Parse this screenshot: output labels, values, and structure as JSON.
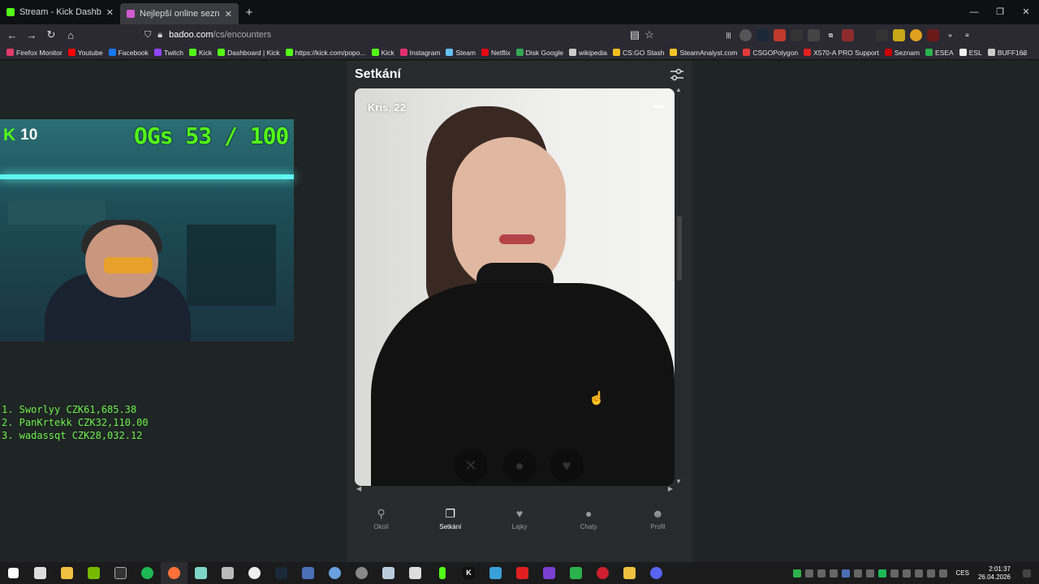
{
  "tabs": [
    {
      "title": "Stream - Kick Dashboard",
      "color": "#53fc18"
    },
    {
      "title": "Nejlepší online seznamka zdarma",
      "color": "#d35ad1"
    }
  ],
  "tab_close": "✕",
  "new_tab": "+",
  "window_controls": {
    "minimize": "—",
    "restore": "❐",
    "close": "✕"
  },
  "nav": {
    "back": "←",
    "forward": "→",
    "reload": "↻",
    "home": "⌂"
  },
  "url": {
    "host": "badoo.com",
    "path": "/cs/encounters"
  },
  "bookmarks": [
    {
      "label": "Firefox Monitor",
      "color": "#e23a6a"
    },
    {
      "label": "Youtube",
      "color": "#ff0000"
    },
    {
      "label": "Facebook",
      "color": "#1877f2"
    },
    {
      "label": "Twitch",
      "color": "#9146ff"
    },
    {
      "label": "Kick",
      "color": "#53fc18"
    },
    {
      "label": "Dashboard | Kick",
      "color": "#53fc18"
    },
    {
      "label": "https://kick.com/popo...",
      "color": "#53fc18"
    },
    {
      "label": "Kick",
      "color": "#53fc18"
    },
    {
      "label": "Instagram",
      "color": "#e1306c"
    },
    {
      "label": "Steam",
      "color": "#66c0f4"
    },
    {
      "label": "Netflix",
      "color": "#e50914"
    },
    {
      "label": "Disk Google",
      "color": "#34a853"
    },
    {
      "label": "wikipedia",
      "color": "#cccccc"
    },
    {
      "label": "CS:GO Stash",
      "color": "#f0c020"
    },
    {
      "label": "SteamAnalyst.com",
      "color": "#f5c428"
    },
    {
      "label": "CSGOPolygon",
      "color": "#e23a3a"
    },
    {
      "label": "X570-A PRO Support",
      "color": "#e02020"
    },
    {
      "label": "Seznam",
      "color": "#cc0000"
    },
    {
      "label": "ESEA",
      "color": "#2bb24c"
    },
    {
      "label": "ESL",
      "color": "#f0f0f0"
    },
    {
      "label": "BUFF163",
      "color": "#cccccc"
    }
  ],
  "bookmarks_more": "»",
  "stream": {
    "kick_count": "10",
    "kick_logo": "K",
    "ogs": "OGs 53 / 100",
    "leaderboard": [
      "1. Sworlyy CZK61,685.38",
      "2. PanKrtekk CZK32,110.00",
      "3. wadassqt CZK28,032.12"
    ]
  },
  "app": {
    "title": "Setkání",
    "card_name": "Kris, 22",
    "card_more": "•••",
    "actions": {
      "dislike": "✕",
      "chat": "●",
      "like": "♥"
    },
    "nav": [
      {
        "label": "Okolí",
        "icon": "⚲",
        "active": false
      },
      {
        "label": "Setkání",
        "icon": "❐",
        "active": true
      },
      {
        "label": "Lajky",
        "icon": "♥",
        "active": false
      },
      {
        "label": "Chaty",
        "icon": "●",
        "active": false
      },
      {
        "label": "Profil",
        "icon": "☻",
        "active": false
      }
    ]
  },
  "taskbar": {
    "lang": "CES",
    "time": "2:01:37",
    "date": "26.04.2026"
  }
}
